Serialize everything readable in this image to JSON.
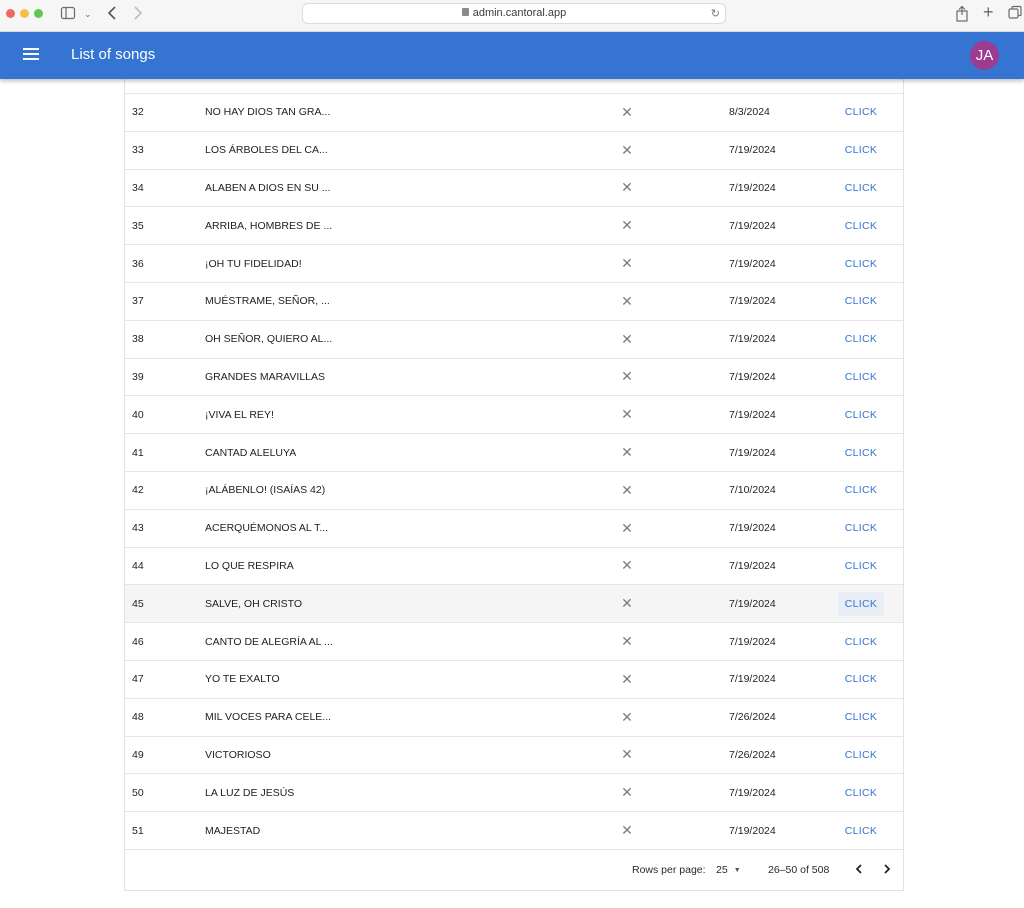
{
  "browser": {
    "url": "admin.cantoral.app"
  },
  "appbar": {
    "title": "List of songs",
    "avatar_initials": "JA",
    "color": "#3574d0",
    "avatar_color": "#9c3b8f"
  },
  "table": {
    "action_label": "CLICK",
    "rows": [
      {
        "num": "32",
        "title": "NO HAY DIOS TAN GRA...",
        "date": "8/3/2024"
      },
      {
        "num": "33",
        "title": "LOS ÁRBOLES DEL CA...",
        "date": "7/19/2024"
      },
      {
        "num": "34",
        "title": "ALABEN A DIOS EN SU ...",
        "date": "7/19/2024"
      },
      {
        "num": "35",
        "title": "ARRIBA, HOMBRES DE ...",
        "date": "7/19/2024"
      },
      {
        "num": "36",
        "title": "¡OH TU FIDELIDAD!",
        "date": "7/19/2024"
      },
      {
        "num": "37",
        "title": "MUÉSTRAME, SEÑOR, ...",
        "date": "7/19/2024"
      },
      {
        "num": "38",
        "title": "OH SEÑOR, QUIERO AL...",
        "date": "7/19/2024"
      },
      {
        "num": "39",
        "title": "GRANDES MARAVILLAS",
        "date": "7/19/2024"
      },
      {
        "num": "40",
        "title": "¡VIVA EL REY!",
        "date": "7/19/2024"
      },
      {
        "num": "41",
        "title": "CANTAD ALELUYA",
        "date": "7/19/2024"
      },
      {
        "num": "42",
        "title": "¡ALÁBENLO! (ISAÍAS 42)",
        "date": "7/10/2024"
      },
      {
        "num": "43",
        "title": "ACERQUÉMONOS AL T...",
        "date": "7/19/2024"
      },
      {
        "num": "44",
        "title": "LO QUE RESPIRA",
        "date": "7/19/2024"
      },
      {
        "num": "45",
        "title": "SALVE, OH CRISTO",
        "date": "7/19/2024"
      },
      {
        "num": "46",
        "title": "CANTO DE ALEGRÍA AL ...",
        "date": "7/19/2024"
      },
      {
        "num": "47",
        "title": "YO TE EXALTO",
        "date": "7/19/2024"
      },
      {
        "num": "48",
        "title": "MIL VOCES PARA CELE...",
        "date": "7/26/2024"
      },
      {
        "num": "49",
        "title": "VICTORIOSO",
        "date": "7/26/2024"
      },
      {
        "num": "50",
        "title": "LA LUZ DE JESÚS",
        "date": "7/19/2024"
      },
      {
        "num": "51",
        "title": "MAJESTAD",
        "date": "7/19/2024"
      }
    ]
  },
  "pagination": {
    "rows_per_page_label": "Rows per page:",
    "rows_per_page_value": "25",
    "range": "26–50 of 508"
  }
}
